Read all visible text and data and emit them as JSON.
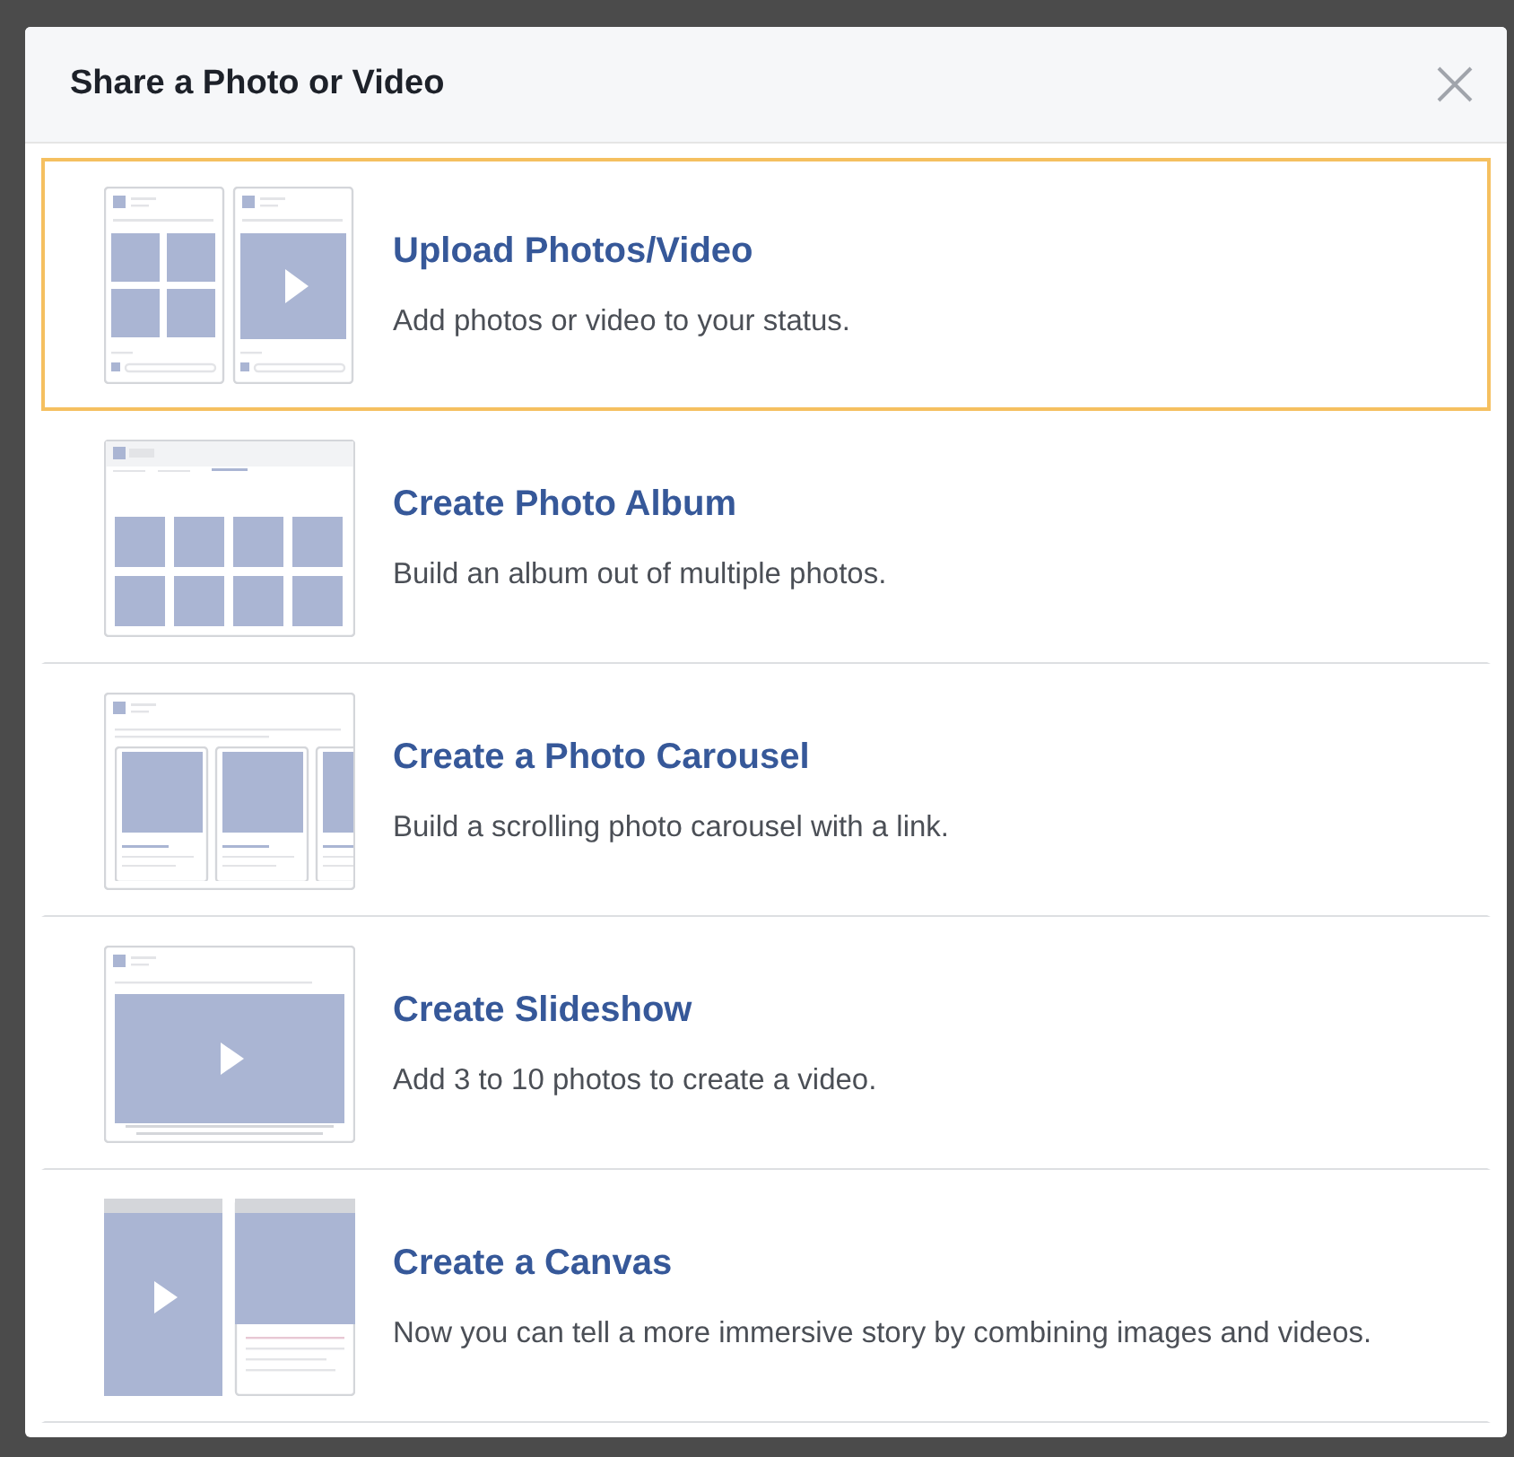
{
  "dialog": {
    "title": "Share a Photo or Video"
  },
  "options": [
    {
      "kind": "upload",
      "title": "Upload Photos/Video",
      "description": "Add photos or video to your status.",
      "selected": true
    },
    {
      "kind": "album",
      "title": "Create Photo Album",
      "description": "Build an album out of multiple photos.",
      "selected": false
    },
    {
      "kind": "carousel",
      "title": "Create a Photo Carousel",
      "description": "Build a scrolling photo carousel with a link.",
      "selected": false
    },
    {
      "kind": "slideshow",
      "title": "Create Slideshow",
      "description": "Add 3 to 10 photos to create a video.",
      "selected": false
    },
    {
      "kind": "canvas",
      "title": "Create a Canvas",
      "description": "Now you can tell a more immersive story by combining images and videos.",
      "selected": false
    }
  ]
}
